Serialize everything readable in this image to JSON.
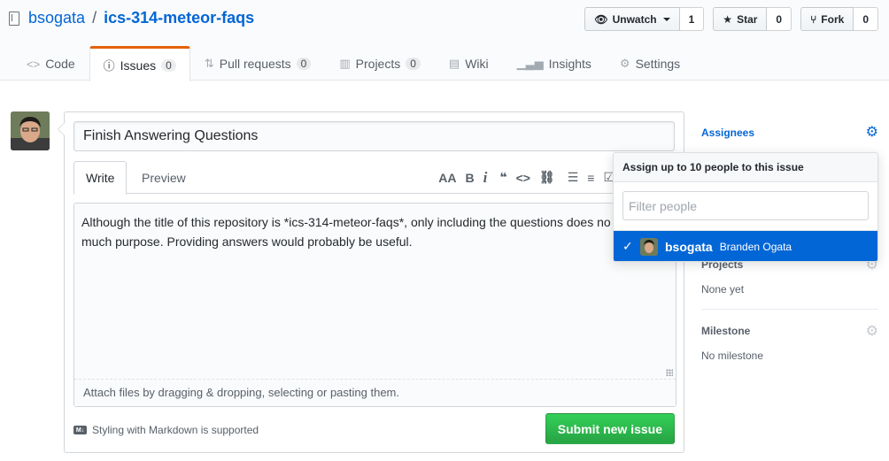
{
  "repo": {
    "owner": "bsogata",
    "separator": "/",
    "name": "ics-314-meteor-faqs"
  },
  "actions": {
    "watch_label": "Unwatch",
    "watch_count": "1",
    "star_label": "Star",
    "star_count": "0",
    "fork_label": "Fork",
    "fork_count": "0"
  },
  "nav": {
    "code": "Code",
    "issues": "Issues",
    "issues_count": "0",
    "pulls": "Pull requests",
    "pulls_count": "0",
    "projects": "Projects",
    "projects_count": "0",
    "wiki": "Wiki",
    "insights": "Insights",
    "settings": "Settings"
  },
  "issue": {
    "title": "Finish Answering Questions",
    "tab_write": "Write",
    "tab_preview": "Preview",
    "body_line1": "Although the title of this repository is *ics-314-meteor-faqs*, only including the questions does no",
    "body_line2": "much purpose.  Providing answers would probably be useful.",
    "attach_hint": "Attach files by dragging & dropping, selecting or pasting them.",
    "markdown_hint": "Styling with Markdown is supported",
    "submit_label": "Submit new issue"
  },
  "toolbar": {
    "heading": "AA",
    "bold": "B",
    "italic": "i",
    "quote": "❝",
    "code": "<>",
    "link": "⛓",
    "ul": "☰",
    "ol": "≡",
    "tasks": "☑"
  },
  "sidebar": {
    "assignees": "Assignees",
    "projects": "Projects",
    "projects_value": "None yet",
    "milestone": "Milestone",
    "milestone_value": "No milestone"
  },
  "assign_menu": {
    "header": "Assign up to 10 people to this issue",
    "filter_placeholder": "Filter people",
    "user_login": "bsogata",
    "user_name": "Branden Ogata"
  }
}
